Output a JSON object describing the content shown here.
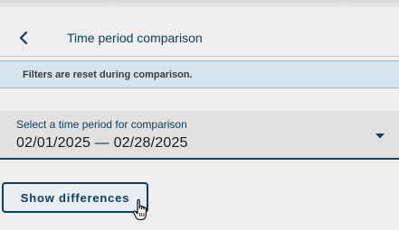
{
  "header": {
    "title": "Time period comparison",
    "back_icon": "chevron-left-icon"
  },
  "notice": {
    "text": "Filters are reset during comparison."
  },
  "period_select": {
    "label": "Select a time period for comparison",
    "value": "02/01/2025 — 02/28/2025",
    "arrow_icon": "caret-down-icon"
  },
  "actions": {
    "show_differences_label": "Show differences"
  },
  "colors": {
    "accent": "#0a3e66",
    "notice_bg": "#d6e4ee",
    "page_bg": "#efefef"
  }
}
